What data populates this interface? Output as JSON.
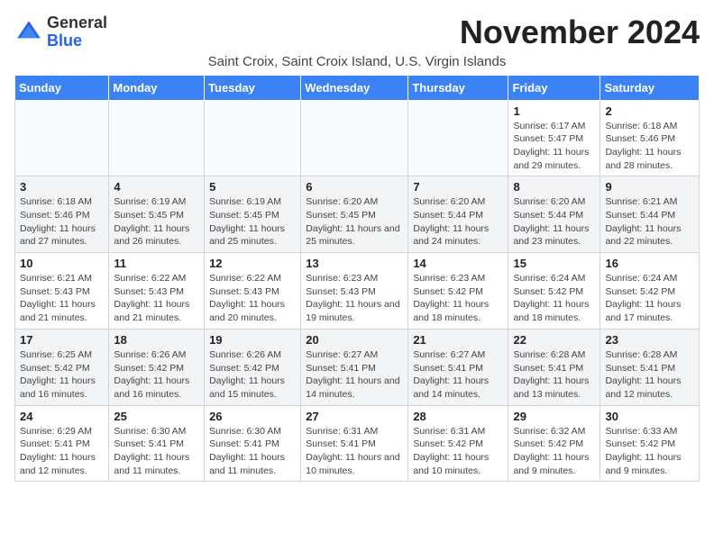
{
  "logo": {
    "line1": "General",
    "line2": "Blue"
  },
  "title": "November 2024",
  "subtitle": "Saint Croix, Saint Croix Island, U.S. Virgin Islands",
  "days_of_week": [
    "Sunday",
    "Monday",
    "Tuesday",
    "Wednesday",
    "Thursday",
    "Friday",
    "Saturday"
  ],
  "weeks": [
    [
      {
        "day": "",
        "info": ""
      },
      {
        "day": "",
        "info": ""
      },
      {
        "day": "",
        "info": ""
      },
      {
        "day": "",
        "info": ""
      },
      {
        "day": "",
        "info": ""
      },
      {
        "day": "1",
        "info": "Sunrise: 6:17 AM\nSunset: 5:47 PM\nDaylight: 11 hours and 29 minutes."
      },
      {
        "day": "2",
        "info": "Sunrise: 6:18 AM\nSunset: 5:46 PM\nDaylight: 11 hours and 28 minutes."
      }
    ],
    [
      {
        "day": "3",
        "info": "Sunrise: 6:18 AM\nSunset: 5:46 PM\nDaylight: 11 hours and 27 minutes."
      },
      {
        "day": "4",
        "info": "Sunrise: 6:19 AM\nSunset: 5:45 PM\nDaylight: 11 hours and 26 minutes."
      },
      {
        "day": "5",
        "info": "Sunrise: 6:19 AM\nSunset: 5:45 PM\nDaylight: 11 hours and 25 minutes."
      },
      {
        "day": "6",
        "info": "Sunrise: 6:20 AM\nSunset: 5:45 PM\nDaylight: 11 hours and 25 minutes."
      },
      {
        "day": "7",
        "info": "Sunrise: 6:20 AM\nSunset: 5:44 PM\nDaylight: 11 hours and 24 minutes."
      },
      {
        "day": "8",
        "info": "Sunrise: 6:20 AM\nSunset: 5:44 PM\nDaylight: 11 hours and 23 minutes."
      },
      {
        "day": "9",
        "info": "Sunrise: 6:21 AM\nSunset: 5:44 PM\nDaylight: 11 hours and 22 minutes."
      }
    ],
    [
      {
        "day": "10",
        "info": "Sunrise: 6:21 AM\nSunset: 5:43 PM\nDaylight: 11 hours and 21 minutes."
      },
      {
        "day": "11",
        "info": "Sunrise: 6:22 AM\nSunset: 5:43 PM\nDaylight: 11 hours and 21 minutes."
      },
      {
        "day": "12",
        "info": "Sunrise: 6:22 AM\nSunset: 5:43 PM\nDaylight: 11 hours and 20 minutes."
      },
      {
        "day": "13",
        "info": "Sunrise: 6:23 AM\nSunset: 5:43 PM\nDaylight: 11 hours and 19 minutes."
      },
      {
        "day": "14",
        "info": "Sunrise: 6:23 AM\nSunset: 5:42 PM\nDaylight: 11 hours and 18 minutes."
      },
      {
        "day": "15",
        "info": "Sunrise: 6:24 AM\nSunset: 5:42 PM\nDaylight: 11 hours and 18 minutes."
      },
      {
        "day": "16",
        "info": "Sunrise: 6:24 AM\nSunset: 5:42 PM\nDaylight: 11 hours and 17 minutes."
      }
    ],
    [
      {
        "day": "17",
        "info": "Sunrise: 6:25 AM\nSunset: 5:42 PM\nDaylight: 11 hours and 16 minutes."
      },
      {
        "day": "18",
        "info": "Sunrise: 6:26 AM\nSunset: 5:42 PM\nDaylight: 11 hours and 16 minutes."
      },
      {
        "day": "19",
        "info": "Sunrise: 6:26 AM\nSunset: 5:42 PM\nDaylight: 11 hours and 15 minutes."
      },
      {
        "day": "20",
        "info": "Sunrise: 6:27 AM\nSunset: 5:41 PM\nDaylight: 11 hours and 14 minutes."
      },
      {
        "day": "21",
        "info": "Sunrise: 6:27 AM\nSunset: 5:41 PM\nDaylight: 11 hours and 14 minutes."
      },
      {
        "day": "22",
        "info": "Sunrise: 6:28 AM\nSunset: 5:41 PM\nDaylight: 11 hours and 13 minutes."
      },
      {
        "day": "23",
        "info": "Sunrise: 6:28 AM\nSunset: 5:41 PM\nDaylight: 11 hours and 12 minutes."
      }
    ],
    [
      {
        "day": "24",
        "info": "Sunrise: 6:29 AM\nSunset: 5:41 PM\nDaylight: 11 hours and 12 minutes."
      },
      {
        "day": "25",
        "info": "Sunrise: 6:30 AM\nSunset: 5:41 PM\nDaylight: 11 hours and 11 minutes."
      },
      {
        "day": "26",
        "info": "Sunrise: 6:30 AM\nSunset: 5:41 PM\nDaylight: 11 hours and 11 minutes."
      },
      {
        "day": "27",
        "info": "Sunrise: 6:31 AM\nSunset: 5:41 PM\nDaylight: 11 hours and 10 minutes."
      },
      {
        "day": "28",
        "info": "Sunrise: 6:31 AM\nSunset: 5:42 PM\nDaylight: 11 hours and 10 minutes."
      },
      {
        "day": "29",
        "info": "Sunrise: 6:32 AM\nSunset: 5:42 PM\nDaylight: 11 hours and 9 minutes."
      },
      {
        "day": "30",
        "info": "Sunrise: 6:33 AM\nSunset: 5:42 PM\nDaylight: 11 hours and 9 minutes."
      }
    ]
  ]
}
